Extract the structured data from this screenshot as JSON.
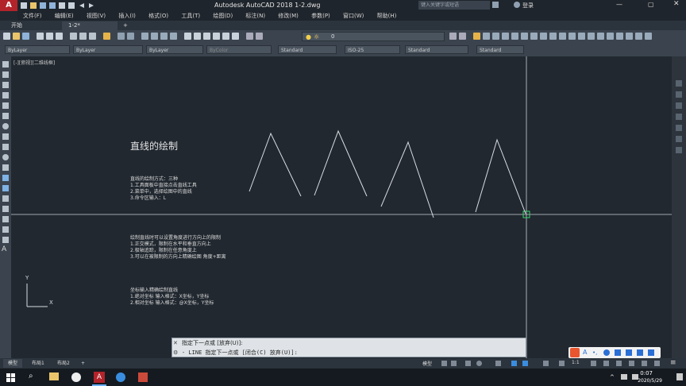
{
  "app": {
    "logo": "A",
    "title": "Autodesk AutoCAD 2018    1-2.dwg",
    "search_placeholder": "键入关键字或短语",
    "user": "登录"
  },
  "menu": [
    "文件(F)",
    "编辑(E)",
    "视图(V)",
    "插入(I)",
    "格式(O)",
    "工具(T)",
    "绘图(D)",
    "标注(N)",
    "修改(M)",
    "参数(P)",
    "窗口(W)",
    "帮助(H)"
  ],
  "tabs": [
    {
      "label": "开始"
    },
    {
      "label": "1-2*"
    },
    {
      "label": "+"
    }
  ],
  "properties": {
    "color": "ByLayer",
    "linetype": "ByLayer",
    "lineweight": "ByLayer",
    "plotstyle": "ByColor",
    "text_style": "Standard",
    "dim_style": "ISO-25",
    "table_style": "Standard",
    "multileader_style": "Standard",
    "layer": "0"
  },
  "viewport_label": "[-][俯视][二维线框]",
  "drawing": {
    "heading": "直线的绘制",
    "block1": [
      "直线的绘制方式：三种",
      "1.工具面板中直接点击直线工具",
      "2.菜单中，选择绘图中的直线",
      "3.命令区输入：L"
    ],
    "block2": [
      "绘制直线时可以设置角度进行方向上的限制",
      "1.正交模式，限制在水平和垂直方向上",
      "2.极轴追踪，限制在任意角度上",
      "3.可以在被限制的方向上精确绘图    角度+距离"
    ],
    "block3": [
      "坐标输入精确绘制直线",
      "1.绝对坐标   输入格式：X坐标，Y坐标",
      "2.相对坐标   输入格式：@X坐标，Y坐标"
    ],
    "ucs": {
      "x": "X",
      "y": "Y"
    }
  },
  "command": {
    "history": "指定下一点或 [放弃(U)]:",
    "prompt": "- LINE 指定下一点或 [闭合(C) 放弃(U)]:"
  },
  "layouts": [
    {
      "label": "模型"
    },
    {
      "label": "布局1"
    },
    {
      "label": "布局2"
    },
    {
      "label": "+"
    }
  ],
  "status": {
    "model": "模型",
    "scale": "1:1"
  },
  "clock": {
    "time": "0:07",
    "date": "2020/5/29"
  },
  "colors": {
    "accent": "#b3232a",
    "canvas": "#212830",
    "toolbar": "#3b444e"
  }
}
